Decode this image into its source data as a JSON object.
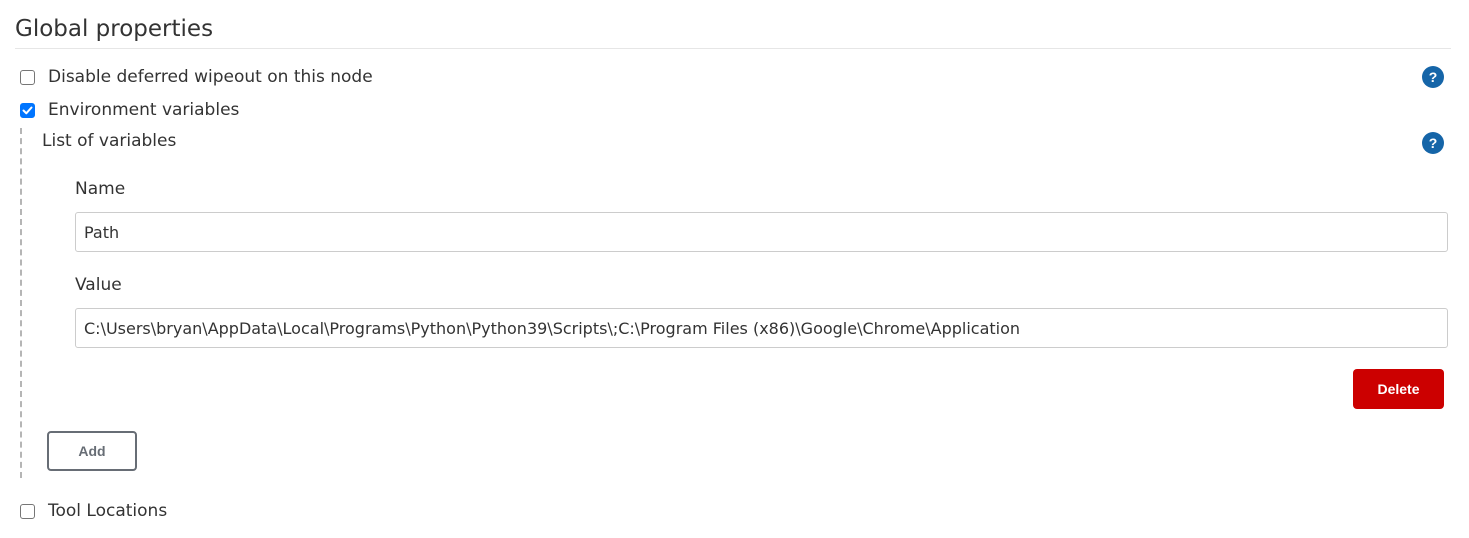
{
  "section": {
    "title": "Global properties"
  },
  "options": {
    "disable_wipeout": {
      "label": "Disable deferred wipeout on this node",
      "checked": false
    },
    "env_vars": {
      "label": "Environment variables",
      "checked": true
    },
    "tool_locations": {
      "label": "Tool Locations",
      "checked": false
    }
  },
  "env": {
    "list_label": "List of variables",
    "entries": [
      {
        "name_label": "Name",
        "name_value": "Path",
        "value_label": "Value",
        "value_value": "C:\\Users\\bryan\\AppData\\Local\\Programs\\Python\\Python39\\Scripts\\;C:\\Program Files (x86)\\Google\\Chrome\\Application",
        "delete_label": "Delete"
      }
    ],
    "add_label": "Add"
  },
  "icons": {
    "help": "help-icon",
    "checkmark": "checkmark-icon"
  },
  "colors": {
    "help_icon": "#1565a8",
    "checkbox_checked": "#0075ff",
    "delete_button": "#cc0000",
    "add_button_border": "#4d545d"
  }
}
